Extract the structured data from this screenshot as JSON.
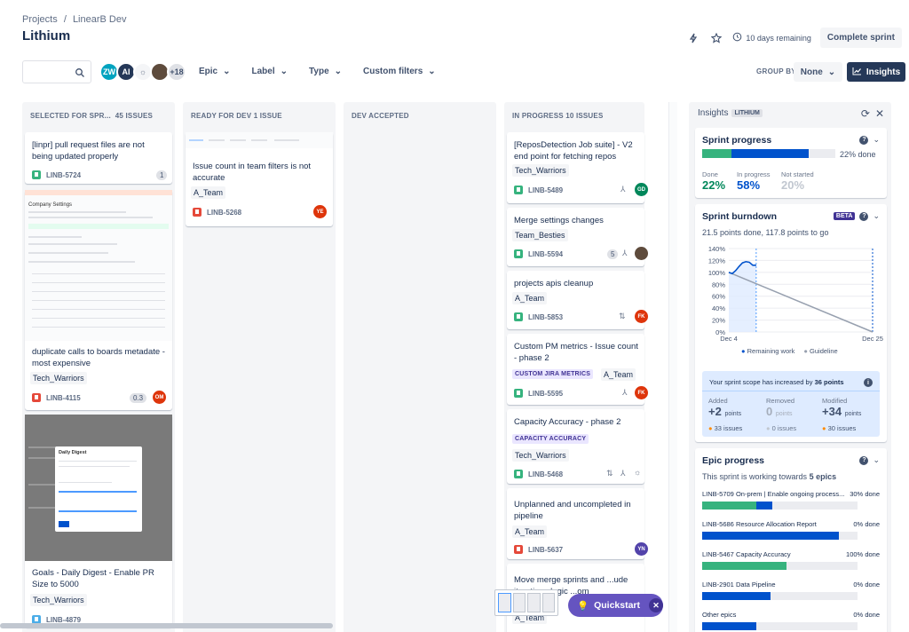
{
  "breadcrumb": {
    "projects": "Projects",
    "sep": "/",
    "project": "LinearB Dev"
  },
  "title": "Lithium",
  "header": {
    "days_remaining": "10 days remaining",
    "complete_sprint": "Complete sprint"
  },
  "toolbar": {
    "avatars": [
      "ZW",
      "AI",
      "",
      "",
      "+18"
    ],
    "filters": [
      "Epic",
      "Label",
      "Type",
      "Custom filters"
    ],
    "group_by": "GROUP BY",
    "group_value": "None",
    "insights": "Insights"
  },
  "columns": [
    {
      "header": "SELECTED FOR SPR...",
      "count": "45 ISSUES"
    },
    {
      "header": "READY FOR DEV",
      "count": "1 ISSUE"
    },
    {
      "header": "DEV ACCEPTED",
      "count": ""
    },
    {
      "header": "IN PROGRESS",
      "count": "10 ISSUES"
    }
  ],
  "col1": [
    {
      "title": "[linpr] pull request files are not being updated properly",
      "key": "LINB-5724",
      "count": "1"
    },
    {
      "title": "duplicate calls to boards metadate - most expensive",
      "team": "Tech_Warriors",
      "key": "LINB-4115",
      "points": "0.3",
      "avatar": "OM"
    },
    {
      "title": "Goals - Daily Digest - Enable PR Size to 5000",
      "team": "Tech_Warriors",
      "key": "LINB-4879"
    }
  ],
  "screenshot1": {
    "title": "Company Settings",
    "modal_title": "Daily Digest"
  },
  "col2": [
    {
      "title": "Issue count in team filters is not accurate",
      "team": "A_Team",
      "key": "LINB-5268",
      "avatar": "YE"
    }
  ],
  "col4": [
    {
      "title": "[ReposDetection Job suite] - V2 end point for fetching repos",
      "team": "Tech_Warriors",
      "key": "LINB-5489",
      "avatar": "GD"
    },
    {
      "title": "Merge settings changes",
      "team": "Team_Besties",
      "key": "LINB-5594",
      "count": "5"
    },
    {
      "title": "projects apis cleanup",
      "team": "A_Team",
      "key": "LINB-5853",
      "avatar": "FK"
    },
    {
      "title": "Custom PM metrics - Issue count - phase 2",
      "epic": "CUSTOM JIRA METRICS",
      "team": "A_Team",
      "key": "LINB-5595",
      "avatar": "FK"
    },
    {
      "title": "Capacity Accuracy - phase 2",
      "epic": "CAPACITY ACCURACY",
      "team": "Tech_Warriors",
      "key": "LINB-5468"
    },
    {
      "title": "Unplanned and uncompleted in pipeline",
      "team": "A_Team",
      "key": "LINB-5637",
      "avatar": "YN"
    },
    {
      "title": "Move merge sprints and ...ude iterations logic ...om",
      "team": "A_Team"
    }
  ],
  "insights": {
    "header": "Insights",
    "badge": "LITHIUM",
    "progress": {
      "title": "Sprint progress",
      "done_pct": "22% done",
      "done_label": "Done",
      "done_val": "22%",
      "inprog_label": "In progress",
      "inprog_val": "58%",
      "ns_label": "Not started",
      "ns_val": "20%",
      "done": 0.22,
      "inprog": 0.58
    },
    "burndown": {
      "title": "Sprint burndown",
      "beta": "BETA",
      "subtitle": "21.5 points done, 117.8 points to go",
      "legend_remaining": "Remaining work",
      "legend_guide": "Guideline",
      "scope": {
        "text": "Your sprint scope has increased by",
        "points": "36 points",
        "added_label": "Added",
        "added": "+2",
        "added_unit": "points",
        "removed_label": "Removed",
        "removed": "0",
        "removed_unit": "points",
        "modified_label": "Modified",
        "modified": "+34",
        "modified_unit": "points",
        "added_issues": "33 issues",
        "removed_issues": "0 issues",
        "modified_issues": "30 issues"
      }
    },
    "epics": {
      "title": "Epic progress",
      "subtitle_pre": "This sprint is working towards",
      "subtitle_bold": "5 epics",
      "items": [
        {
          "name": "LINB-5709 On-prem | Enable ongoing process...",
          "pct": "30% done",
          "done": 0.35,
          "prog": 0.1
        },
        {
          "name": "LINB-5686 Resource Allocation Report",
          "pct": "0% done",
          "done": 0,
          "prog": 0.88
        },
        {
          "name": "LINB-5467 Capacity Accuracy",
          "pct": "100% done",
          "done": 0.54,
          "prog": 0
        },
        {
          "name": "LINB-2901 Data Pipeline",
          "pct": "0% done",
          "done": 0,
          "prog": 0.44
        },
        {
          "name": "Other epics",
          "pct": "0% done",
          "done": 0,
          "prog": 0.35
        }
      ]
    }
  },
  "chart_data": {
    "type": "line",
    "title": "Sprint burndown",
    "y_ticks": [
      "140%",
      "120%",
      "100%",
      "80%",
      "60%",
      "40%",
      "20%",
      "0%"
    ],
    "x_labels": [
      "Dec 4",
      "Dec 25"
    ],
    "ylim": [
      0,
      140
    ],
    "series": [
      {
        "name": "Remaining work",
        "color": "#0052cc",
        "x": [
          0,
          0.5,
          1,
          1.5,
          2,
          2.5,
          3,
          3.5,
          4
        ],
        "values": [
          100,
          98,
          103,
          110,
          116,
          118,
          117,
          112,
          112
        ]
      },
      {
        "name": "Guideline",
        "color": "#97a0af",
        "x": [
          0,
          21
        ],
        "values": [
          100,
          0
        ]
      }
    ],
    "xlim": [
      0,
      21
    ]
  },
  "quickstart": "Quickstart",
  "colors": {
    "story": "#36b37e",
    "bug": "#e5493a",
    "blue": "#0052cc",
    "green": "#36b37e"
  }
}
